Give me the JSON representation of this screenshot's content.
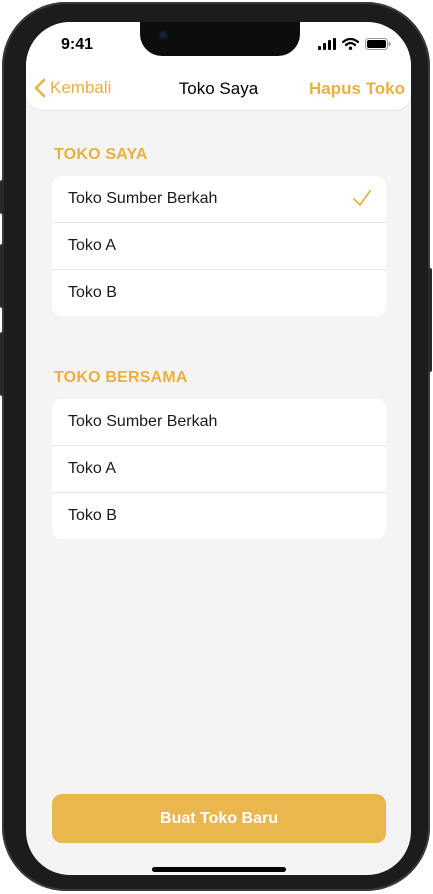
{
  "status": {
    "time": "9:41"
  },
  "nav": {
    "back_label": "Kembali",
    "title": "Toko Saya",
    "action_label": "Hapus Toko"
  },
  "sections": [
    {
      "title": "TOKO SAYA",
      "items": [
        {
          "label": "Toko Sumber Berkah",
          "selected": true
        },
        {
          "label": "Toko A"
        },
        {
          "label": "Toko B"
        }
      ]
    },
    {
      "title": "TOKO BERSAMA",
      "items": [
        {
          "label": "Toko Sumber Berkah"
        },
        {
          "label": "Toko A"
        },
        {
          "label": "Toko B"
        }
      ]
    }
  ],
  "cta": {
    "label": "Buat Toko Baru"
  },
  "colors": {
    "accent": "#e8b041",
    "button": "#eab64e",
    "background": "#f4f4f4"
  }
}
